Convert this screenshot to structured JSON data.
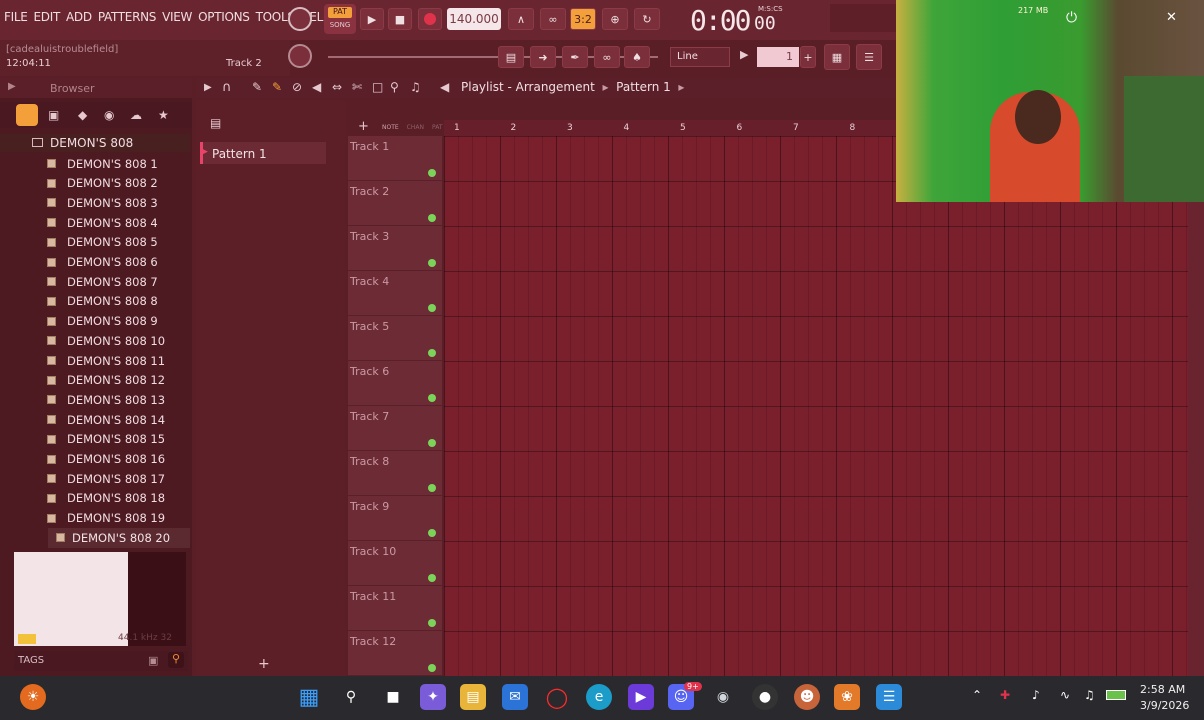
{
  "menu": [
    "FILE",
    "EDIT",
    "ADD",
    "PATTERNS",
    "VIEW",
    "OPTIONS",
    "TOOLS",
    "HELP"
  ],
  "transport": {
    "pat_label": "PAT",
    "song_label": "SONG",
    "tempo": "140.000",
    "time": "0:00",
    "time_sub": "00",
    "time_unit": "M:S:CS",
    "cpu_meter": "217 MB"
  },
  "hint": {
    "line1": "[cadealuistroublefield]",
    "line2": "12:04:11",
    "track": "Track 2"
  },
  "snap": {
    "line_value": "Line",
    "step": "1"
  },
  "browser": {
    "title": "Browser",
    "folder": "DEMON'S 808",
    "items": [
      "DEMON'S 808 1",
      "DEMON'S 808 2",
      "DEMON'S 808 3",
      "DEMON'S 808 4",
      "DEMON'S 808 5",
      "DEMON'S 808 6",
      "DEMON'S 808 7",
      "DEMON'S 808 8",
      "DEMON'S 808 9",
      "DEMON'S 808 10",
      "DEMON'S 808 11",
      "DEMON'S 808 12",
      "DEMON'S 808 13",
      "DEMON'S 808 14",
      "DEMON'S 808 15",
      "DEMON'S 808 16",
      "DEMON'S 808 17",
      "DEMON'S 808 18",
      "DEMON'S 808 19"
    ],
    "selected": "DEMON'S 808 20",
    "sample_info": "44.1 kHz 32",
    "tags": "TAGS"
  },
  "patterns": {
    "item": "Pattern 1"
  },
  "playlist": {
    "title": "Playlist - Arrangement",
    "pattern": "Pattern 1",
    "sub_tabs": [
      "NOTE",
      "CHAN",
      "PAT"
    ],
    "ruler": [
      "1",
      "2",
      "3",
      "4",
      "5",
      "6",
      "7",
      "8"
    ],
    "tracks": [
      "Track 1",
      "Track 2",
      "Track 3",
      "Track 4",
      "Track 5",
      "Track 6",
      "Track 7",
      "Track 8",
      "Track 9",
      "Track 10",
      "Track 11",
      "Track 12"
    ]
  },
  "taskbar": {
    "time": "2:58 AM",
    "date": "3/9/2026",
    "badge": "9+"
  },
  "colors": {
    "accent": "#e8446a",
    "bg": "#5a1e26",
    "grid": "#7a1f2c",
    "track_led": "#7cd35a"
  }
}
